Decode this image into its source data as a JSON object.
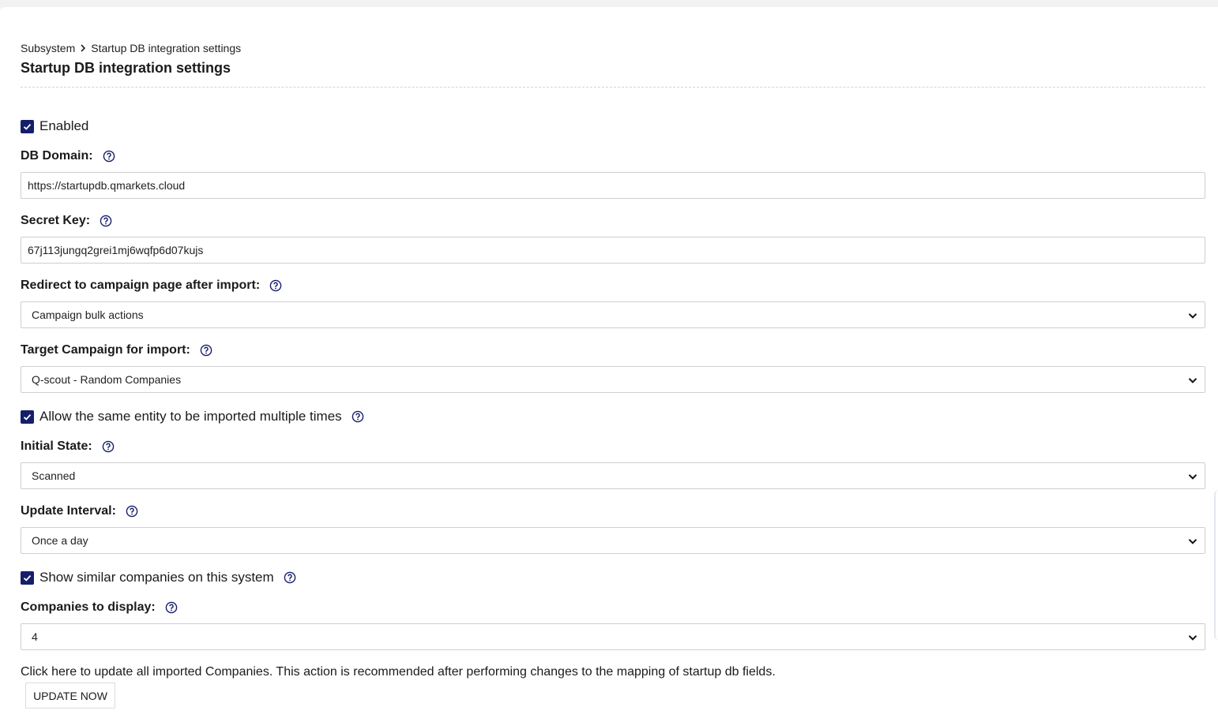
{
  "breadcrumb": {
    "items": [
      "Subsystem",
      "Startup DB integration settings"
    ]
  },
  "page_title": "Startup DB integration settings",
  "enabled": {
    "label": "Enabled",
    "checked": true
  },
  "db_domain": {
    "label": "DB Domain:",
    "value": "https://startupdb.qmarkets.cloud"
  },
  "secret_key": {
    "label": "Secret Key:",
    "value": "67j113jungq2grei1mj6wqfp6d07kujs"
  },
  "redirect": {
    "label": "Redirect to campaign page after import:",
    "selected": "Campaign bulk actions"
  },
  "target_campaign": {
    "label": "Target Campaign for import:",
    "selected": "Q-scout - Random Companies"
  },
  "allow_multiple": {
    "label": "Allow the same entity to be imported multiple times",
    "checked": true
  },
  "initial_state": {
    "label": "Initial State:",
    "selected": "Scanned"
  },
  "update_interval": {
    "label": "Update Interval:",
    "selected": "Once a day"
  },
  "show_similar": {
    "label": "Show similar companies on this system",
    "checked": true
  },
  "companies_to_display": {
    "label": "Companies to display:",
    "selected": "4"
  },
  "update_info": "Click here to update all imported Companies. This action is recommended after performing changes to the mapping of startup db fields.",
  "update_button": "UPDATE NOW",
  "icons": {
    "help": "question-circle-icon",
    "check": "checkmark-icon",
    "chevron": "chevron-down-icon",
    "breadcrumb_separator": "chevron-right-icon"
  },
  "colors": {
    "checkbox": "#161e6b",
    "help_icon": "#161e6b",
    "border": "#cfcfcf"
  }
}
